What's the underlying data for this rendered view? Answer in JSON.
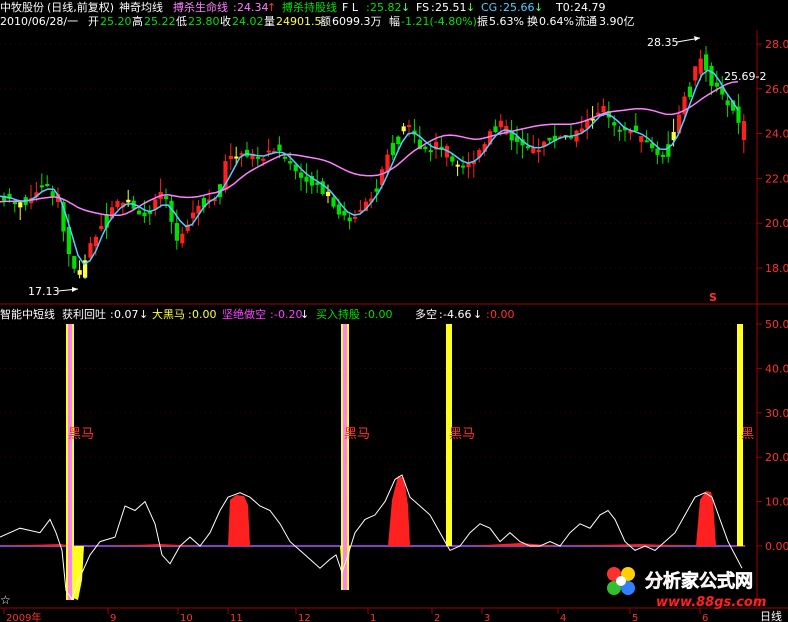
{
  "header": {
    "stock_name": "中牧股份",
    "period": "(日线,前复权)",
    "ma_name": "神奇均线",
    "line1_label": "搏杀生命线",
    "line1_value": "24.34",
    "line2_label": "搏杀持股线",
    "fl_label": "F L",
    "fl_value": "25.82",
    "fs_label": "FS",
    "fs_value": "25.51",
    "cg_label": "CG",
    "cg_value": "25.66",
    "t0_label": "T0",
    "t0_value": "24.79"
  },
  "quote": {
    "date": "2010/06/28/一",
    "open_label": "开",
    "open": "25.20",
    "high_label": "高",
    "high": "25.22",
    "low_label": "低",
    "low": "23.80",
    "close_label": "收",
    "close": "24.02",
    "vol_label": "量",
    "vol": "24901.5",
    "amount_label": "额",
    "amount": "6099.3万",
    "change_label": "幅",
    "change": "-1.21(-4.80%)",
    "amplitude_label": "振",
    "amplitude": "5.63%",
    "turnover_label": "换",
    "turnover": "0.64%",
    "float_label": "流通",
    "float": "3.90亿"
  },
  "sub_header": {
    "indicator": "智能中短线",
    "l1_label": "获利回吐",
    "l1_value": "0.07",
    "l2_label": "大黑马",
    "l2_value": "0.00",
    "l3_label": "坚绝做空",
    "l3_value": "-0.20",
    "l4_label": "买入持股",
    "l4_value": "0.00",
    "l5_label": "多空",
    "l5_value": "-4.66",
    "l6_value": "0.00"
  },
  "annotations": {
    "price_high": "28.35",
    "price_low": "17.13",
    "price_right": "25.69-2",
    "sell_marker": "S",
    "dark_horse": "黑马",
    "star": "☆",
    "right_bottom": "日线"
  },
  "watermark": {
    "site": "分析家公式网",
    "url": "www.88gs.com"
  },
  "colors": {
    "up": "#ff2020",
    "down": "#00e000",
    "ma_purple": "#ff80ff",
    "ma_cyan": "#50d0ff",
    "yellow": "#ffff40",
    "grid": "#a00000"
  },
  "chart_data": [
    {
      "type": "candlestick",
      "ylim": [
        17,
        29
      ],
      "y_ticks": [
        "18.00",
        "20.00",
        "22.00",
        "24.00",
        "26.00",
        "28.00"
      ],
      "x_ticks": [
        "2009年",
        "9",
        "10",
        "11",
        "12",
        "1",
        "2",
        "3",
        "4",
        "5",
        "6"
      ],
      "series": [
        {
          "name": "搏杀生命线",
          "color": "#ff80ff"
        },
        {
          "name": "搏杀持股线",
          "color": "#50d0ff"
        }
      ]
    },
    {
      "type": "area",
      "ylim": [
        -6,
        52
      ],
      "y_ticks": [
        "0.00",
        "10.00",
        "20.00",
        "30.00",
        "40.00",
        "50.00"
      ],
      "labels": [
        "黑马",
        "黑马",
        "黑马",
        "黑"
      ]
    }
  ]
}
